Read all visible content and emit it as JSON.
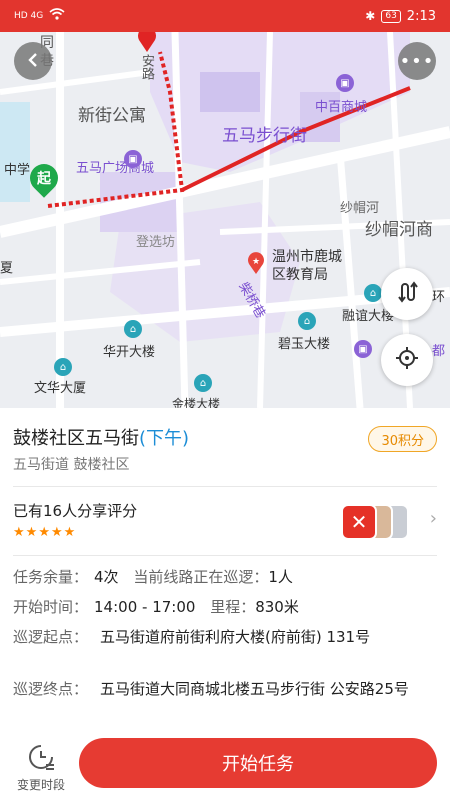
{
  "statusbar": {
    "left_icons": "HD 4G",
    "battery": "63",
    "time": "2:13"
  },
  "map": {
    "labels": [
      {
        "text": "同",
        "cls": "gray"
      },
      {
        "text": "巷",
        "cls": "gray"
      },
      {
        "text": "安路",
        "cls": "gray"
      },
      {
        "text": "新街公寓",
        "cls": "big"
      },
      {
        "text": "中百商城",
        "cls": "purple"
      },
      {
        "text": "五马步行街",
        "cls": "purplebig"
      },
      {
        "text": "中学",
        "cls": "dark"
      },
      {
        "text": "五马广场商城",
        "cls": "purple"
      },
      {
        "text": "纱帽河",
        "cls": "gray"
      },
      {
        "text": "纱帽河商",
        "cls": "big"
      },
      {
        "text": "登选坊",
        "cls": "gray"
      },
      {
        "text": "温州市鹿城",
        "cls": "dark"
      },
      {
        "text": "区教育局",
        "cls": "dark"
      },
      {
        "text": "柴桥巷",
        "cls": "purple"
      },
      {
        "text": "华开大楼",
        "cls": "dark"
      },
      {
        "text": "碧玉大楼",
        "cls": "dark"
      },
      {
        "text": "融谊大楼",
        "cls": "dark"
      },
      {
        "text": "文华大厦",
        "cls": "dark"
      },
      {
        "text": "环",
        "cls": "dark"
      },
      {
        "text": "都",
        "cls": "purple"
      },
      {
        "text": "夏",
        "cls": "dark"
      },
      {
        "text": "金楼大楼",
        "cls": "dark"
      }
    ],
    "start_marker": "起",
    "back_icon": "back-arrow-icon",
    "more_icon": "more-icon",
    "route_icon": "route-icon",
    "locate_icon": "locate-icon"
  },
  "task": {
    "title": "鼓楼社区五马街",
    "time_tag": "(下午)",
    "subtitle": "五马街道 鼓楼社区",
    "points_badge": "30积分",
    "rating_text": "已有16人分享评分",
    "rating": 5,
    "rows": [
      {
        "label": "任务余量：",
        "value": "4次",
        "label2": "当前线路正在巡逻：",
        "value2": "1人"
      },
      {
        "label": "开始时间：",
        "value": "14:00 - 17:00",
        "label2": "里程：",
        "value2": "830米"
      }
    ],
    "start_point_label": "巡逻起点：",
    "start_point": "五马街道府前街利府大楼(府前街) 131号",
    "end_point_label": "巡逻终点：",
    "end_point": "五马街道大同商城北楼五马步行街 公安路25号"
  },
  "bottom": {
    "change_time_label": "变更时段",
    "start_button": "开始任务"
  },
  "colors": {
    "primary": "#e63b32",
    "route": "#e02424",
    "accent_blue": "#1c8dd6",
    "badge": "#e68a00"
  }
}
